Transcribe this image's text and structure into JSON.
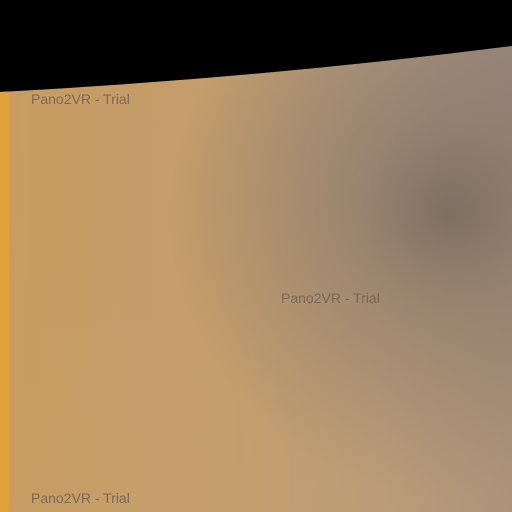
{
  "panorama": {
    "watermarks": [
      "Pano2VR - Trial",
      "Pano2VR - Trial",
      "Pano2VR - Trial"
    ],
    "colors": {
      "sky": "#000000",
      "surface_light": "#c59a5f",
      "surface_mid": "#b89a74",
      "shadow": "#7d7068",
      "edge_strip": "#e0a23a"
    }
  }
}
